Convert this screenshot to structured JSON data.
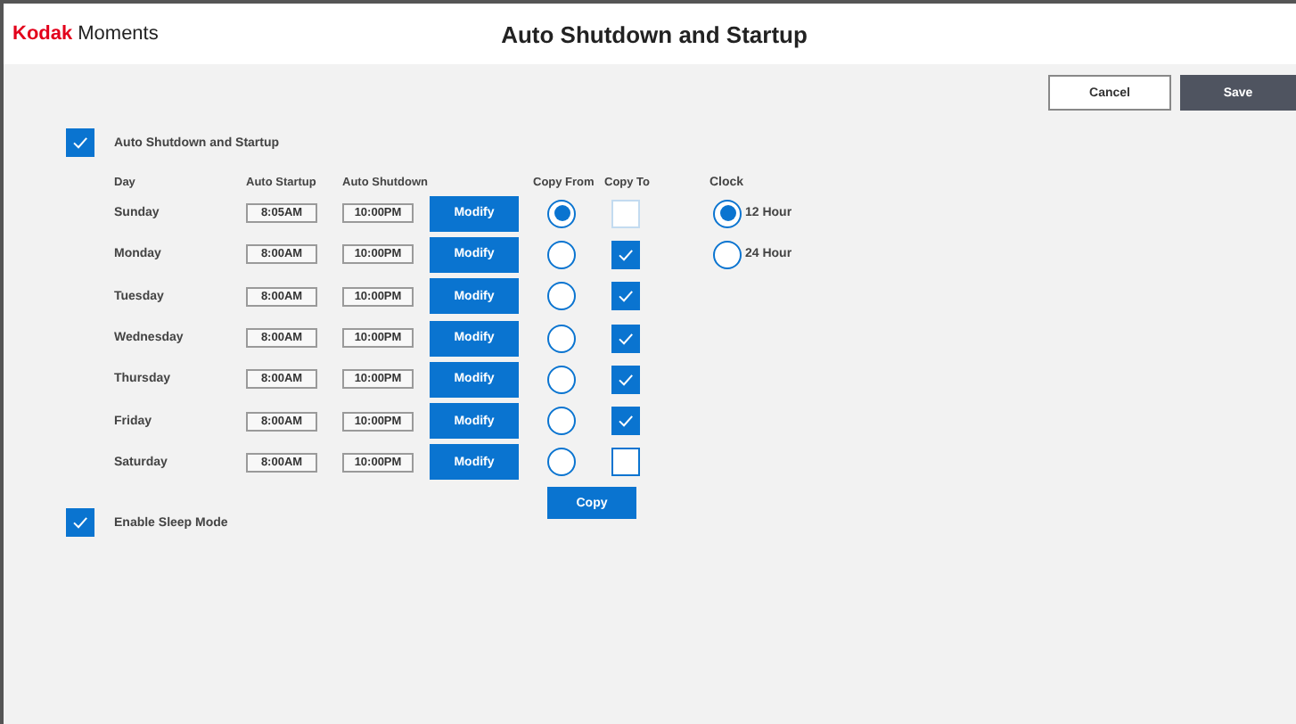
{
  "brand": {
    "name": "Kodak",
    "suffix": "Moments"
  },
  "title": "Auto Shutdown and Startup",
  "buttons": [
    {
      "label": "Cancel",
      "kind": "secondary"
    },
    {
      "label": "Save",
      "kind": "primary"
    }
  ],
  "auto_shutdown": {
    "label": "Auto Shutdown and Startup",
    "checked": true
  },
  "columns": [
    "Day",
    "Auto Startup",
    "Auto Shutdown",
    "Copy From",
    "Copy To"
  ],
  "days": [
    {
      "day": "Sunday",
      "startup": "8:05AM",
      "shutdown": "10:00PM",
      "action": "Modify",
      "copy_from": {
        "selected": true
      },
      "copy_to": {
        "checked": false,
        "disabled": true
      }
    },
    {
      "day": "Monday",
      "startup": "8:00AM",
      "shutdown": "10:00PM",
      "action": "Modify",
      "copy_from": {
        "selected": false
      },
      "copy_to": {
        "checked": true,
        "disabled": false
      }
    },
    {
      "day": "Tuesday",
      "startup": "8:00AM",
      "shutdown": "10:00PM",
      "action": "Modify",
      "copy_from": {
        "selected": false
      },
      "copy_to": {
        "checked": true,
        "disabled": false
      }
    },
    {
      "day": "Wednesday",
      "startup": "8:00AM",
      "shutdown": "10:00PM",
      "action": "Modify",
      "copy_from": {
        "selected": false
      },
      "copy_to": {
        "checked": true,
        "disabled": false
      }
    },
    {
      "day": "Thursday",
      "startup": "8:00AM",
      "shutdown": "10:00PM",
      "action": "Modify",
      "copy_from": {
        "selected": false
      },
      "copy_to": {
        "checked": true,
        "disabled": false
      }
    },
    {
      "day": "Friday",
      "startup": "8:00AM",
      "shutdown": "10:00PM",
      "action": "Modify",
      "copy_from": {
        "selected": false
      },
      "copy_to": {
        "checked": true,
        "disabled": false
      }
    },
    {
      "day": "Saturday",
      "startup": "8:00AM",
      "shutdown": "10:00PM",
      "action": "Modify",
      "copy_from": {
        "selected": false
      },
      "copy_to": {
        "checked": false,
        "disabled": false
      }
    }
  ],
  "copy_button": "Copy",
  "clock": {
    "label": "Clock",
    "options": [
      {
        "label": "12 Hour",
        "selected": true
      },
      {
        "label": "24 Hour",
        "selected": false
      }
    ]
  },
  "sleep_mode": {
    "label": "Enable Sleep Mode",
    "checked": true
  }
}
